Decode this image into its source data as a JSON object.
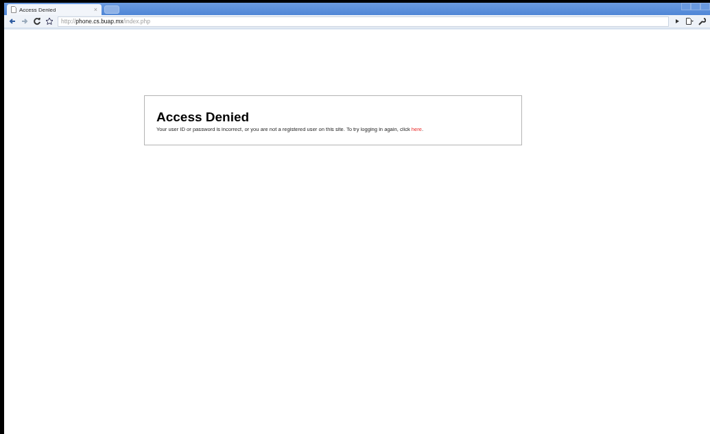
{
  "browser": {
    "tabs": [
      {
        "title": "Access Denied",
        "close": "×",
        "selected": true
      }
    ],
    "address": {
      "scheme": "http://",
      "host": "phone.cs.buap.mx",
      "path": "/index.php"
    }
  },
  "page": {
    "heading": "Access Denied",
    "message_before": "Your user ID or password is incorrect, or you are not a registered user on this site. To try logging in again, click ",
    "link": "here",
    "message_after": "."
  }
}
